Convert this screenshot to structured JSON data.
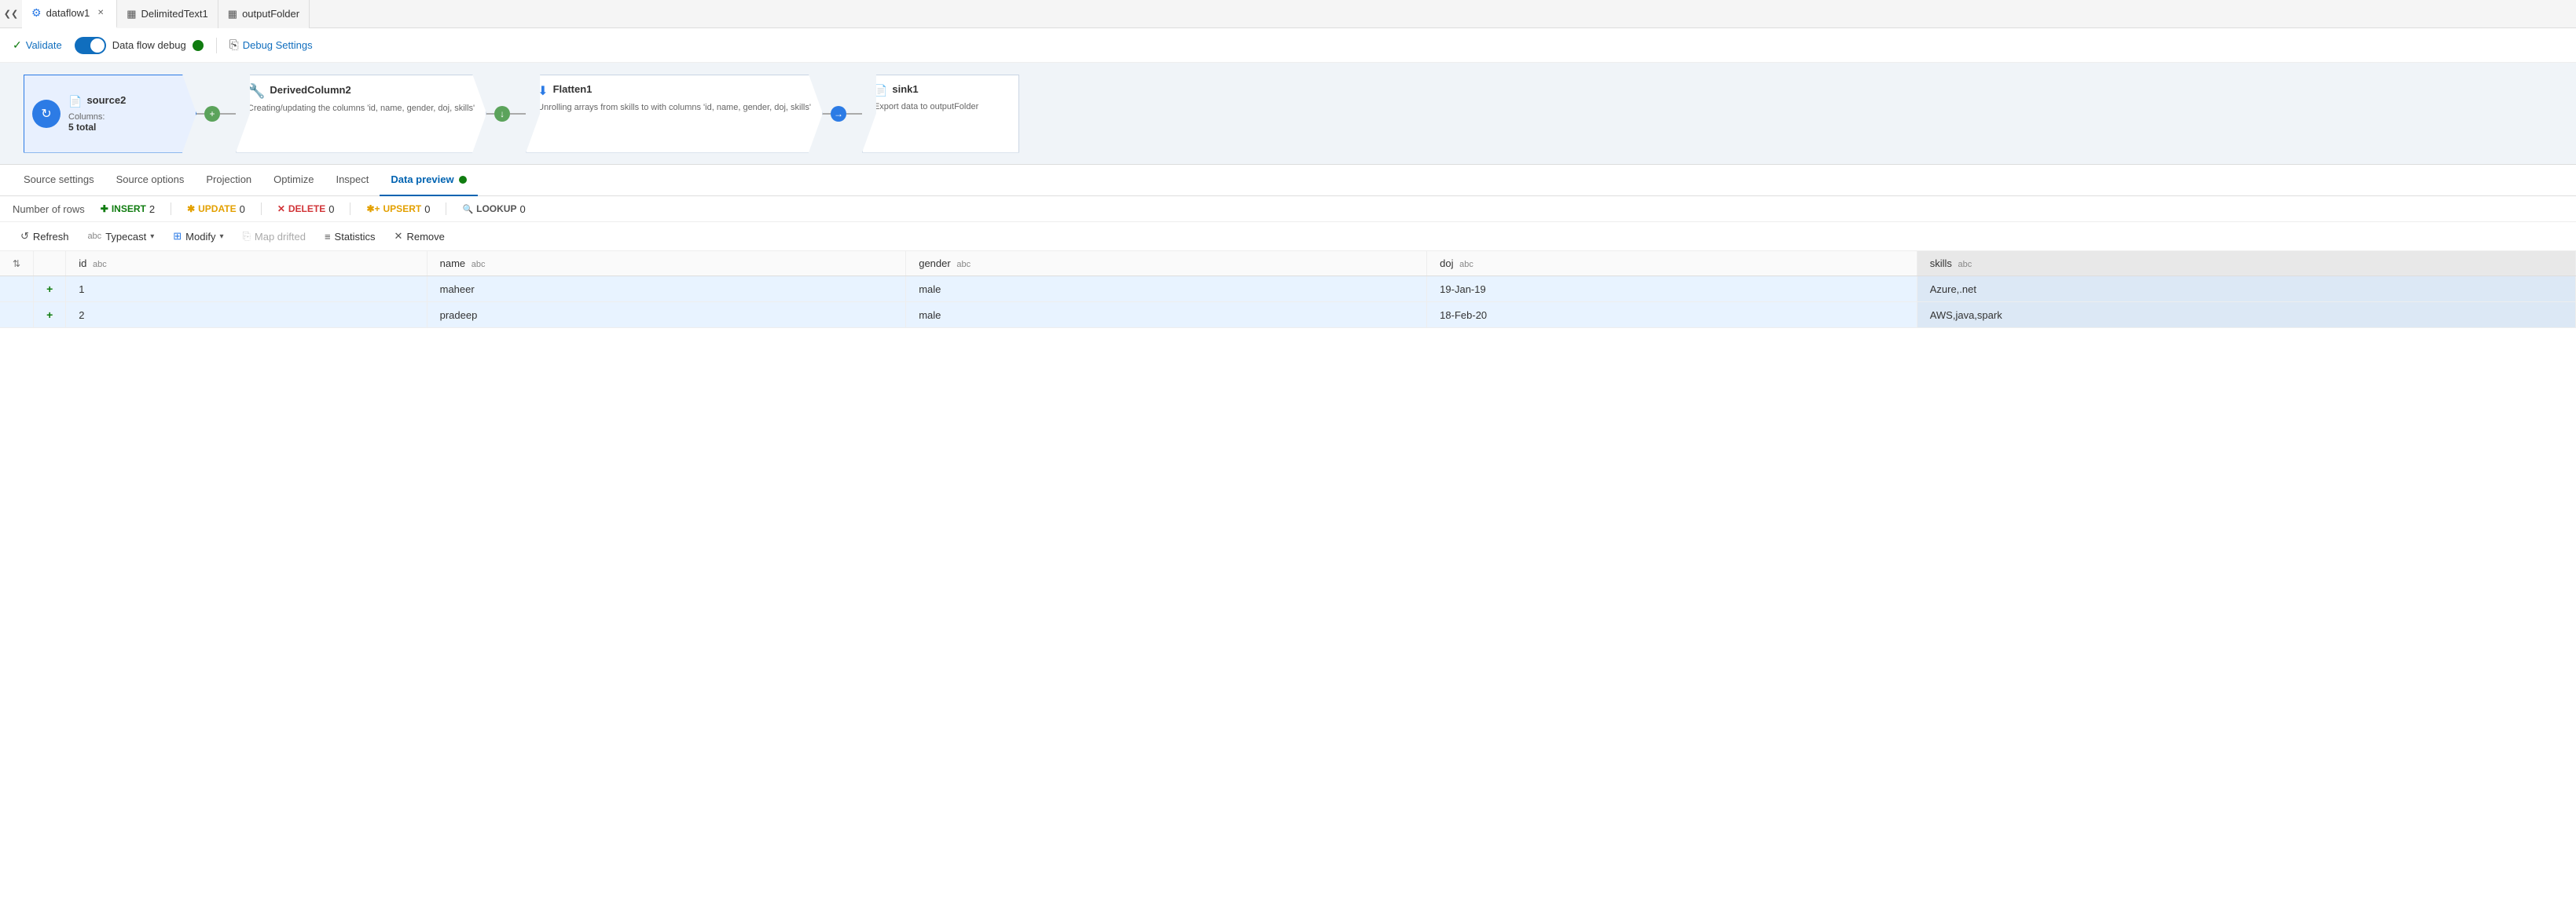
{
  "tabs": [
    {
      "id": "dataflow1",
      "label": "dataflow1",
      "icon": "⚙",
      "active": true,
      "closeable": true
    },
    {
      "id": "delimited",
      "label": "DelimitedText1",
      "icon": "▦",
      "active": false,
      "closeable": false
    },
    {
      "id": "outputFolder",
      "label": "outputFolder",
      "icon": "▦",
      "active": false,
      "closeable": false
    }
  ],
  "toolbar": {
    "validate_label": "Validate",
    "debug_label": "Data flow debug",
    "debug_settings_label": "Debug Settings"
  },
  "pipeline": {
    "nodes": [
      {
        "id": "source2",
        "title": "source2",
        "subtitle_label": "Columns:",
        "subtitle_value": "5 total",
        "type": "source"
      },
      {
        "id": "derivedColumn2",
        "title": "DerivedColumn2",
        "description": "Creating/updating the columns 'id, name, gender, doj, skills'",
        "type": "transform"
      },
      {
        "id": "flatten1",
        "title": "Flatten1",
        "description": "Unrolling arrays from skills to with columns 'id, name, gender, doj, skills'",
        "type": "transform"
      },
      {
        "id": "sink1",
        "title": "sink1",
        "description": "Export data to outputFolder",
        "type": "sink"
      }
    ]
  },
  "sub_tabs": [
    {
      "id": "source-settings",
      "label": "Source settings"
    },
    {
      "id": "source-options",
      "label": "Source options"
    },
    {
      "id": "projection",
      "label": "Projection"
    },
    {
      "id": "optimize",
      "label": "Optimize"
    },
    {
      "id": "inspect",
      "label": "Inspect"
    },
    {
      "id": "data-preview",
      "label": "Data preview",
      "active": true,
      "has_dot": true
    }
  ],
  "stats": {
    "rows_label": "Number of rows",
    "insert_label": "INSERT",
    "insert_value": "2",
    "update_label": "UPDATE",
    "update_value": "0",
    "delete_label": "DELETE",
    "delete_value": "0",
    "upsert_label": "UPSERT",
    "upsert_value": "0",
    "lookup_label": "LOOKUP",
    "lookup_value": "0"
  },
  "action_toolbar": {
    "refresh_label": "Refresh",
    "typecast_label": "Typecast",
    "modify_label": "Modify",
    "map_drifted_label": "Map drifted",
    "statistics_label": "Statistics",
    "remove_label": "Remove"
  },
  "table": {
    "columns": [
      {
        "id": "sort",
        "label": "",
        "type": ""
      },
      {
        "id": "marker",
        "label": "",
        "type": ""
      },
      {
        "id": "id",
        "label": "id",
        "type": "abc"
      },
      {
        "id": "name",
        "label": "name",
        "type": "abc"
      },
      {
        "id": "gender",
        "label": "gender",
        "type": "abc"
      },
      {
        "id": "doj",
        "label": "doj",
        "type": "abc"
      },
      {
        "id": "skills",
        "label": "skills",
        "type": "abc",
        "highlighted": true
      }
    ],
    "rows": [
      {
        "marker": "+",
        "id": "1",
        "name": "maheer",
        "gender": "male",
        "doj": "19-Jan-19",
        "skills": "Azure,.net"
      },
      {
        "marker": "+",
        "id": "2",
        "name": "pradeep",
        "gender": "male",
        "doj": "18-Feb-20",
        "skills": "AWS,java,spark"
      }
    ]
  }
}
